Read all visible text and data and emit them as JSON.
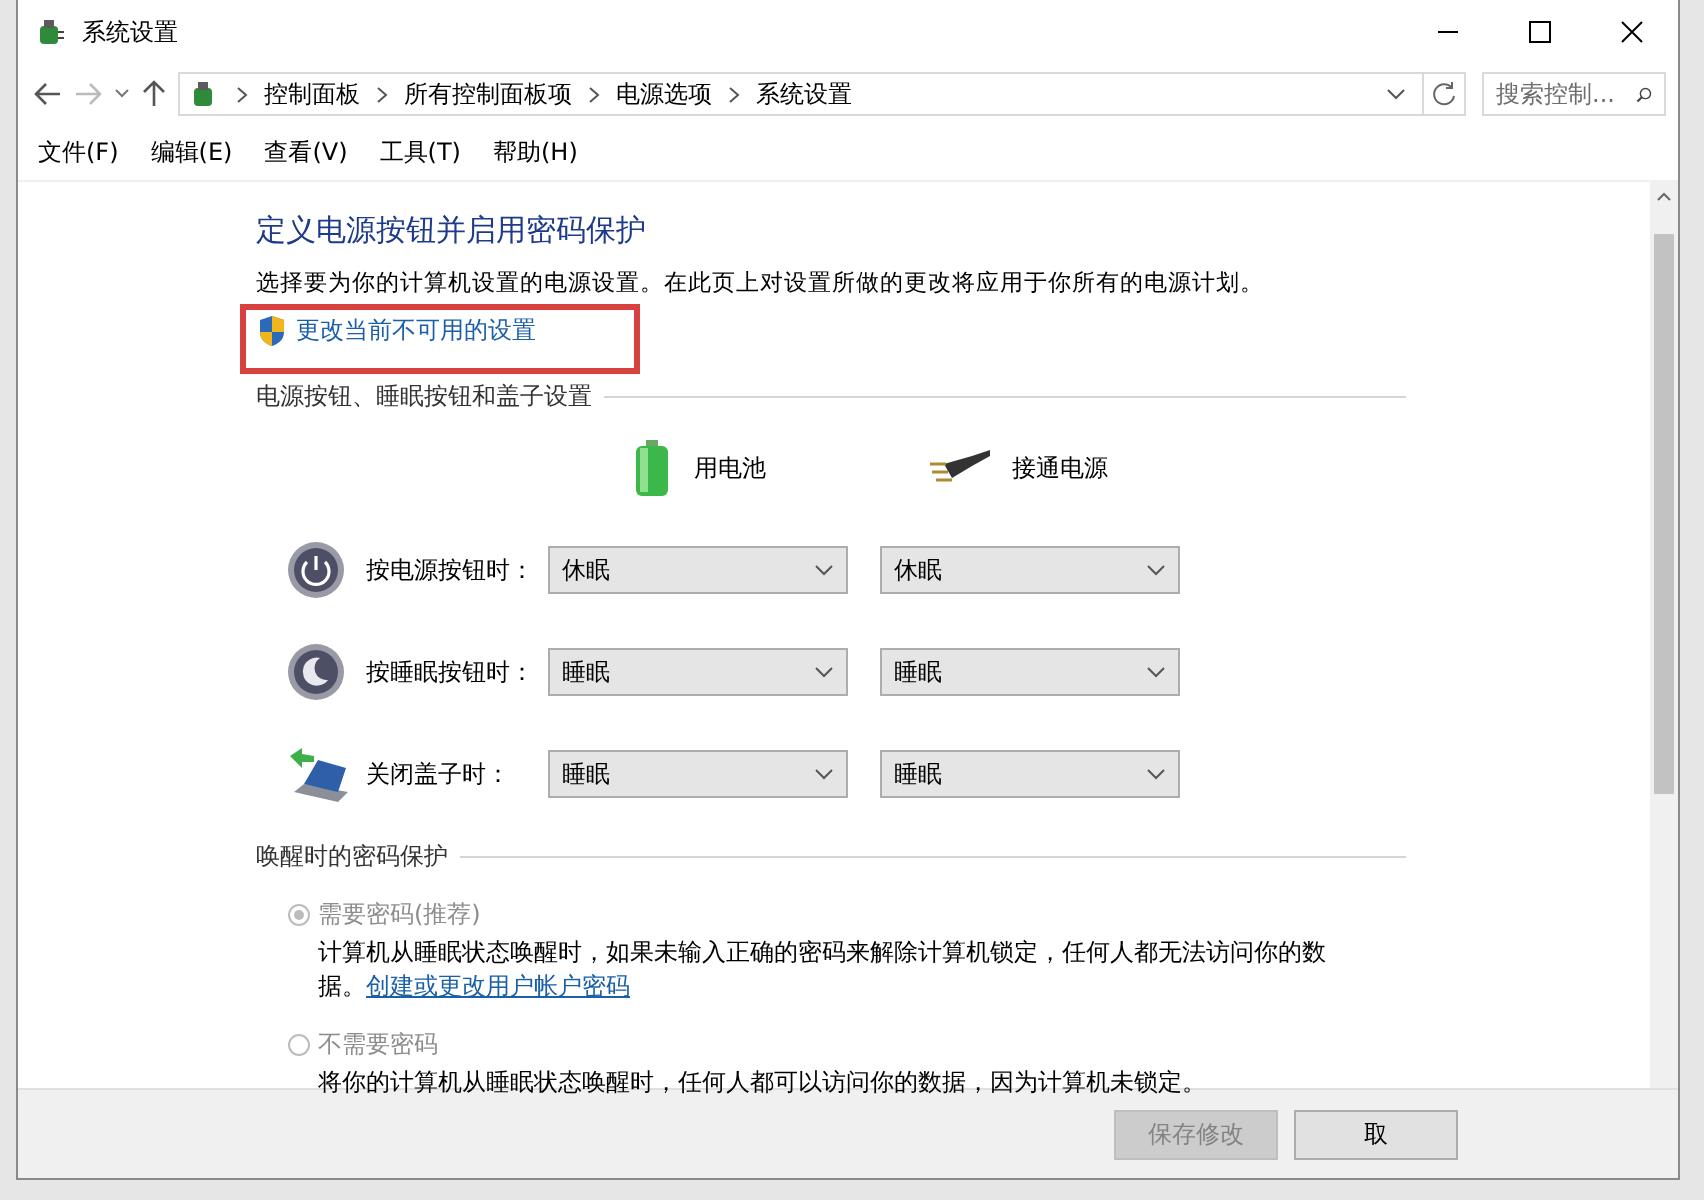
{
  "window": {
    "title": "系统设置"
  },
  "address_bar": {
    "path": [
      "控制面板",
      "所有控制面板项",
      "电源选项",
      "系统设置"
    ]
  },
  "search": {
    "placeholder": "搜索控制..."
  },
  "menu": [
    "文件(F)",
    "编辑(E)",
    "查看(V)",
    "工具(T)",
    "帮助(H)"
  ],
  "heading": "定义电源按钮并启用密码保护",
  "description": "选择要为你的计算机设置的电源设置。在此页上对设置所做的更改将应用于你所有的电源计划。",
  "admin_link": {
    "text": "更改当前不可用的设置",
    "highlighted": true
  },
  "power_section": {
    "title": "电源按钮、睡眠按钮和盖子设置",
    "columns": [
      {
        "label": "用电池",
        "kind": "battery"
      },
      {
        "label": "接通电源",
        "kind": "plug"
      }
    ],
    "rows": [
      {
        "label": "按电源按钮时：",
        "kind": "power",
        "values": [
          "休眠",
          "休眠"
        ]
      },
      {
        "label": "按睡眠按钮时：",
        "kind": "sleep",
        "values": [
          "睡眠",
          "睡眠"
        ]
      },
      {
        "label": "关闭盖子时：",
        "kind": "lid",
        "values": [
          "睡眠",
          "睡眠"
        ]
      }
    ]
  },
  "password_section": {
    "title": "唤醒时的密码保护",
    "disabled": true,
    "options": [
      {
        "label": "需要密码(推荐)",
        "selected": true,
        "description": "计算机从睡眠状态唤醒时，如果未输入正确的密码来解除计算机锁定，任何人都无法访问你的数据。",
        "link": "创建或更改用户帐户密码"
      },
      {
        "label": "不需要密码",
        "selected": false,
        "description": "将你的计算机从睡眠状态唤醒时，任何人都可以访问你的数据，因为计算机未锁定。"
      }
    ]
  },
  "buttons": [
    {
      "label": "保存修改",
      "disabled": true
    },
    {
      "label": "取",
      "disabled": false
    }
  ]
}
